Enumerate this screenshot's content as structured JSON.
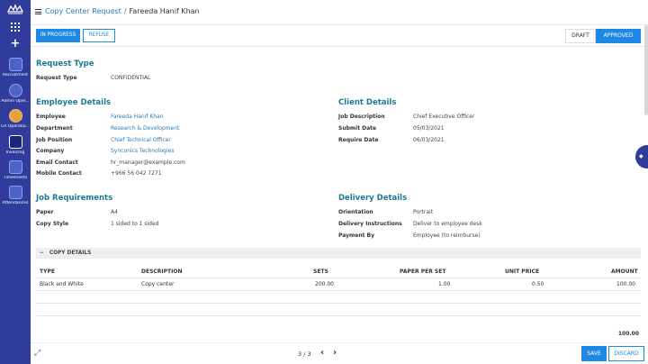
{
  "sidebar": {
    "apps": [
      {
        "label": "Recruitment",
        "icon": "recruitment-icon"
      },
      {
        "label": "Admin Oper...",
        "icon": "admin-icon"
      },
      {
        "label": "CR Operatio...",
        "icon": "cr-operations-icon"
      },
      {
        "label": "Invoicing",
        "icon": "invoicing-icon"
      },
      {
        "label": "Timesheets",
        "icon": "timesheets-icon"
      },
      {
        "label": "Attendances",
        "icon": "attendances-icon"
      }
    ]
  },
  "breadcrumb": {
    "parent": "Copy Center Request",
    "separator": "/",
    "current": "Fareeda Hanif Khan"
  },
  "actions": {
    "in_progress": "IN PROGRESS",
    "refuse": "REFUSE"
  },
  "stages": {
    "draft": "DRAFT",
    "approved": "APPROVED"
  },
  "request_type": {
    "title": "Request Type",
    "label": "Request Type",
    "value": "CONFIDENTIAL"
  },
  "employee": {
    "title": "Employee Details",
    "rows": [
      {
        "label": "Employee",
        "value": "Fareeda Hanif Khan"
      },
      {
        "label": "Department",
        "value": "Research & Development"
      },
      {
        "label": "Job Position",
        "value": "Chief Technical Officer"
      },
      {
        "label": "Company",
        "value": "Synconics Technologies"
      },
      {
        "label": "Email Contact",
        "value": "hr_manager@example.com"
      },
      {
        "label": "Mobile Contact",
        "value": "+966 56 042 7271"
      }
    ]
  },
  "client": {
    "title": "Client Details",
    "rows": [
      {
        "label": "Job Description",
        "value": "Chief Executive Officer"
      },
      {
        "label": "Submit Date",
        "value": "05/03/2021"
      },
      {
        "label": "Require Date",
        "value": "06/03/2021"
      }
    ]
  },
  "job": {
    "title": "Job Requirements",
    "rows": [
      {
        "label": "Paper",
        "value": "A4"
      },
      {
        "label": "Copy Style",
        "value": "1 sided to 1 sided"
      }
    ]
  },
  "delivery": {
    "title": "Delivery Details",
    "rows": [
      {
        "label": "Orientation",
        "value": "Portrait"
      },
      {
        "label": "Delivery Instructions",
        "value": "Deliver to employee desk"
      },
      {
        "label": "Payment By",
        "value": "Employee (to reimburse)"
      }
    ]
  },
  "copy_details": {
    "title": "COPY DETAILS",
    "headers": [
      "TYPE",
      "DESCRIPTION",
      "SETS",
      "PAPER PER SET",
      "UNIT PRICE",
      "AMOUNT"
    ],
    "row": [
      "Black and White",
      "Copy center",
      "200.00",
      "1.00",
      "0.50",
      "100.00"
    ],
    "total": "100.00"
  },
  "footer": {
    "pager": "3 / 3",
    "prev": "‹",
    "next": "›",
    "save": "SAVE",
    "discard": "DISCARD"
  },
  "colors": {
    "sidebar": "#2f3c9c",
    "accent": "#1e88e5",
    "section_title": "#1c7a93"
  }
}
